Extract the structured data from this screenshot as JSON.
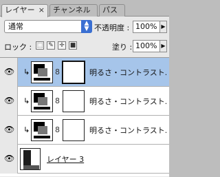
{
  "tabs": [
    {
      "label": "レイヤー",
      "close": "×",
      "active": true
    },
    {
      "label": "チャンネル",
      "active": false
    },
    {
      "label": "パス",
      "active": false
    }
  ],
  "blend_mode": {
    "value": "通常",
    "arrow": "▲▼"
  },
  "opacity": {
    "label": "不透明度 :",
    "value": "100%"
  },
  "lock": {
    "label": "ロック :",
    "icons": [
      "lock-transparent-icon",
      "lock-paint-icon",
      "lock-move-icon",
      "lock-all-icon"
    ]
  },
  "fill": {
    "label": "塗り :",
    "value": "100%"
  },
  "layers": [
    {
      "name": "明るさ・コントラスト...",
      "type": "adjustment",
      "selected": true,
      "visible": true,
      "clipped": true
    },
    {
      "name": "明るさ・コントラスト...",
      "type": "adjustment",
      "selected": false,
      "visible": true,
      "clipped": true
    },
    {
      "name": "明るさ・コントラスト...",
      "type": "adjustment",
      "selected": false,
      "visible": true,
      "clipped": true
    },
    {
      "name": "レイヤー 3",
      "type": "image",
      "selected": false,
      "visible": true,
      "clipped": false
    }
  ],
  "glyphs": {
    "eye": "👁",
    "clip": "↳",
    "chain": "8",
    "menu_arrow": "▶"
  }
}
